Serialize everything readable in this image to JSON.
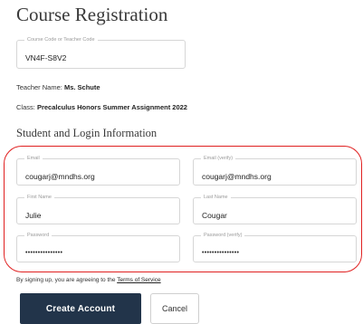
{
  "page": {
    "title": "Course Registration",
    "section_title": "Student and Login Information"
  },
  "course_code": {
    "label": "Course Code or Teacher Code",
    "value": "VN4F-S8V2"
  },
  "teacher": {
    "label": "Teacher Name:",
    "name": "Ms. Schute"
  },
  "class_info": {
    "label": "Class:",
    "name": "Precalculus Honors Summer Assignment 2022"
  },
  "fields": {
    "email": {
      "label": "Email",
      "value": "cougarj@mndhs.org"
    },
    "email_verify": {
      "label": "Email (verify)",
      "value": "cougarj@mndhs.org"
    },
    "first_name": {
      "label": "First Name",
      "value": "Julie"
    },
    "last_name": {
      "label": "Last Name",
      "value": "Cougar"
    },
    "password": {
      "label": "Password",
      "value": "•••••••••••••••"
    },
    "password_verify": {
      "label": "Password (verify)",
      "value": "•••••••••••••••"
    }
  },
  "terms": {
    "prefix": "By signing up, you are agreeing to the",
    "link": "Terms of Service"
  },
  "buttons": {
    "create": "Create Account",
    "cancel": "Cancel"
  },
  "colors": {
    "primary_button": "#22344a",
    "highlight": "#e02020"
  }
}
